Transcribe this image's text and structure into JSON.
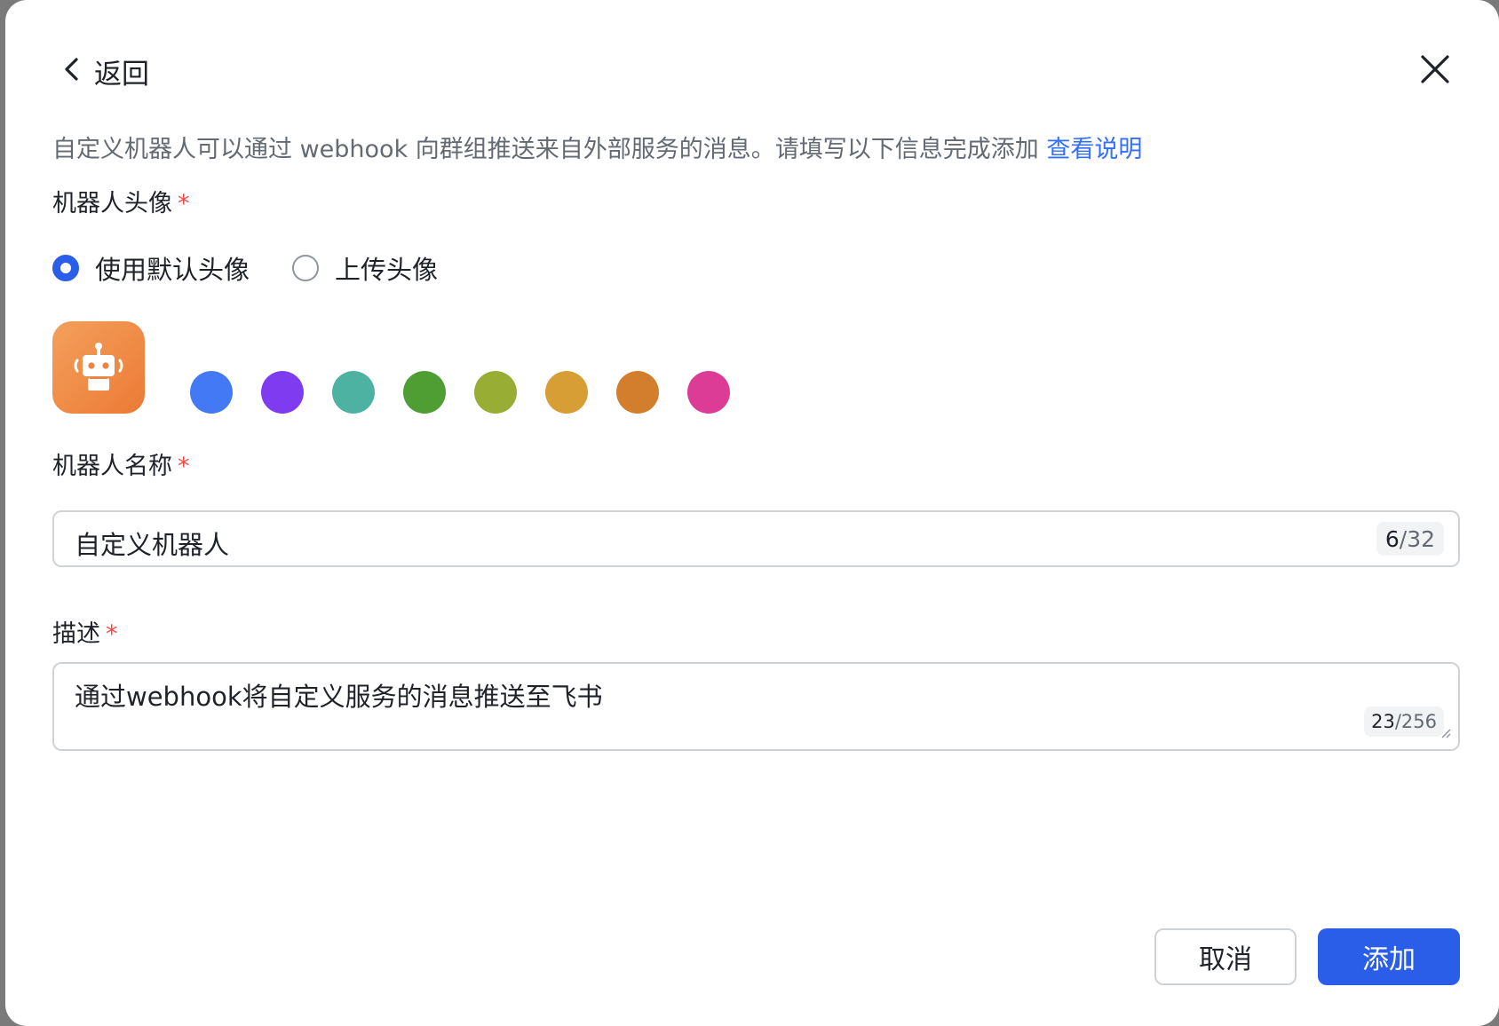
{
  "header": {
    "back_label": "返回"
  },
  "intro": {
    "text": "自定义机器人可以通过 webhook 向群组推送来自外部服务的消息。请填写以下信息完成添加",
    "link": "查看说明"
  },
  "avatar_section": {
    "label": "机器人头像",
    "required_mark": "*",
    "options": [
      {
        "label": "使用默认头像",
        "checked": true
      },
      {
        "label": "上传头像",
        "checked": false
      }
    ],
    "current_avatar_icon": "robot-icon",
    "current_avatar_color": "#ee8240",
    "swatches": [
      "#4479f6",
      "#7f3bf0",
      "#4eb2a2",
      "#4e9e34",
      "#97ad34",
      "#d69e34",
      "#d27e2c",
      "#dd3c96"
    ]
  },
  "name_field": {
    "label": "机器人名称",
    "required_mark": "*",
    "value": "自定义机器人",
    "count_current": "6",
    "count_max": "/32"
  },
  "desc_field": {
    "label": "描述",
    "required_mark": "*",
    "value": "通过webhook将自定义服务的消息推送至飞书",
    "count_current": "23",
    "count_max": "/256"
  },
  "footer": {
    "cancel_label": "取消",
    "add_label": "添加"
  },
  "colors": {
    "primary": "#2b5ee8",
    "link": "#3370ff",
    "required": "#f54a45"
  }
}
